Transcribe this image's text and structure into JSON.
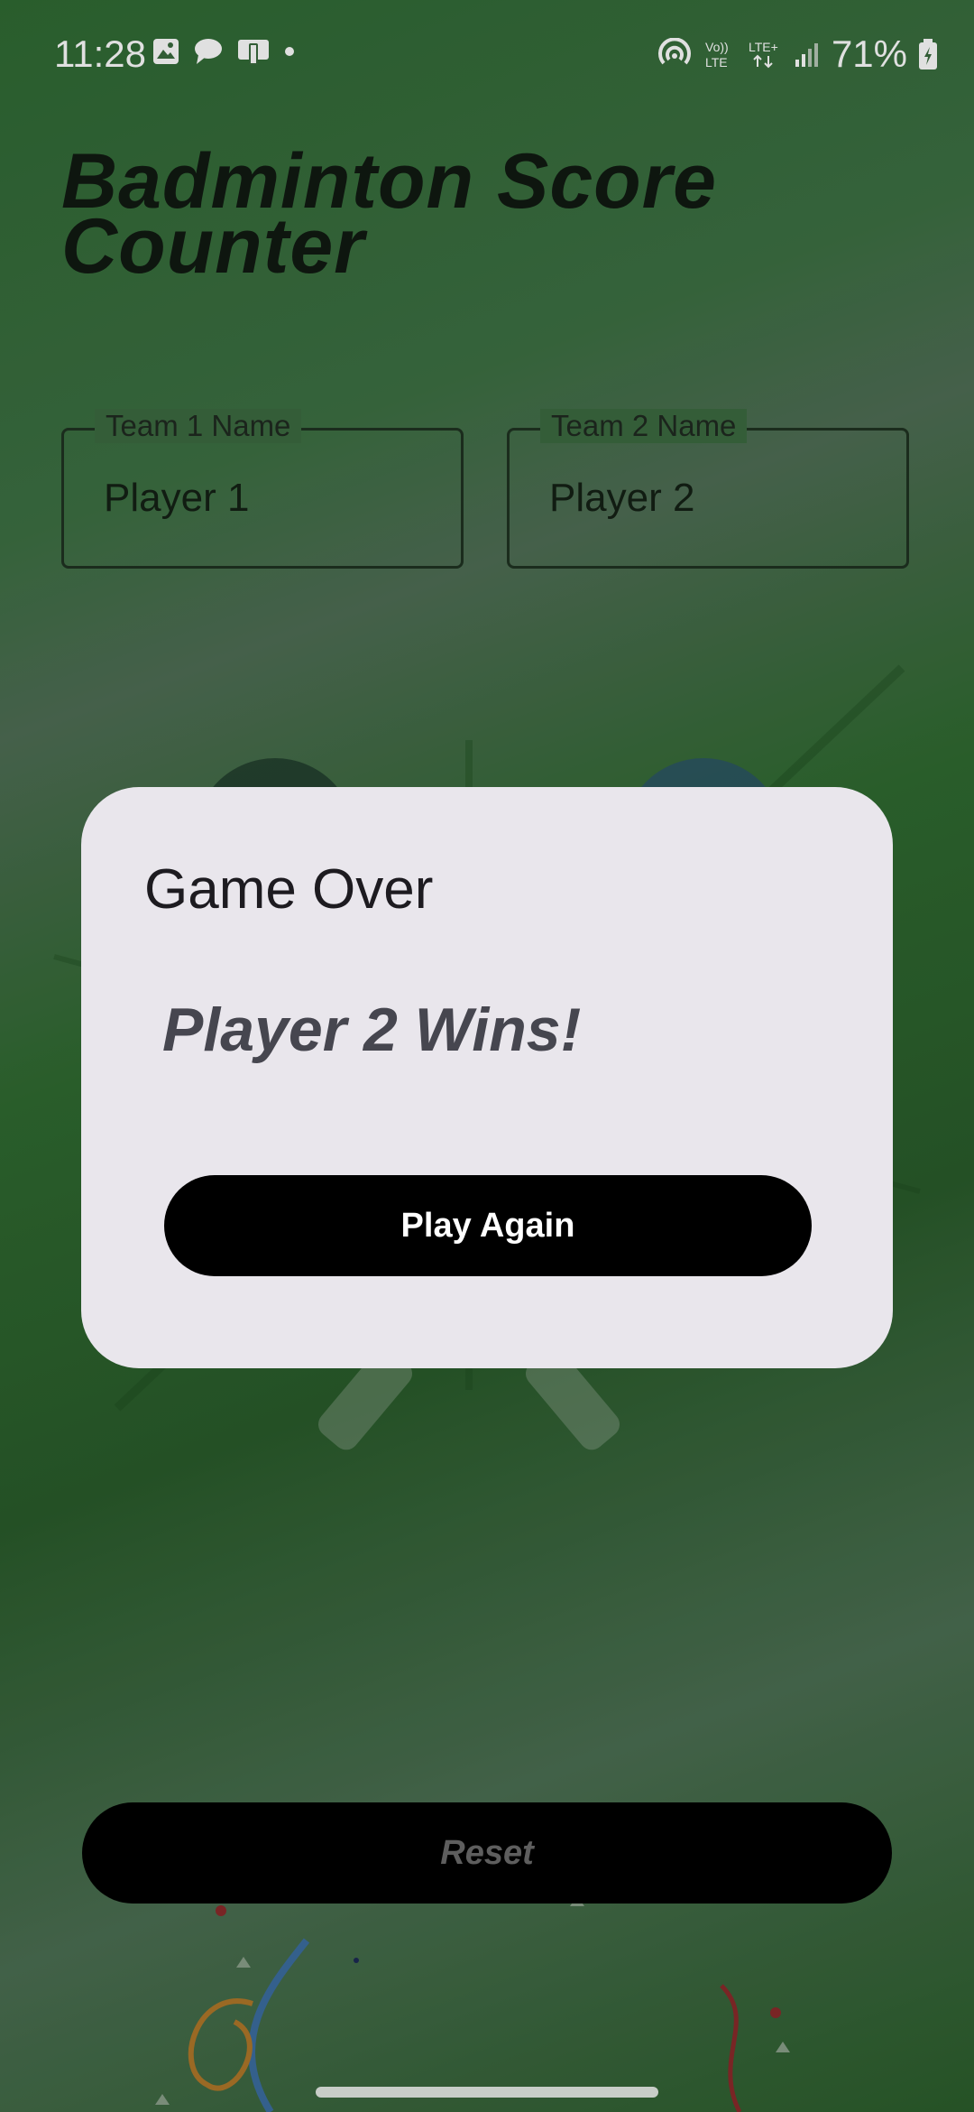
{
  "status_bar": {
    "time": "11:28",
    "battery_percent": "71%",
    "left_icons": [
      "image-icon",
      "chat-bubble-icon",
      "mobile-device-icon",
      "dot-icon"
    ],
    "right_icons": [
      "hotspot-icon",
      "volte-icon",
      "lte-plus-icon",
      "signal-icon",
      "battery-icon"
    ]
  },
  "app": {
    "title": "Badminton Score Counter"
  },
  "team_fields": [
    {
      "label": "Team 1 Name",
      "value": "Player 1"
    },
    {
      "label": "Team 2 Name",
      "value": "Player 2"
    }
  ],
  "dialog": {
    "title": "Game Over",
    "message": "Player 2 Wins!",
    "button_label": "Play Again"
  },
  "reset_button": {
    "label": "Reset"
  },
  "colors": {
    "background_green": "#2f6a33",
    "dialog_bg": "#e9e6ec",
    "button_black": "#000000"
  }
}
